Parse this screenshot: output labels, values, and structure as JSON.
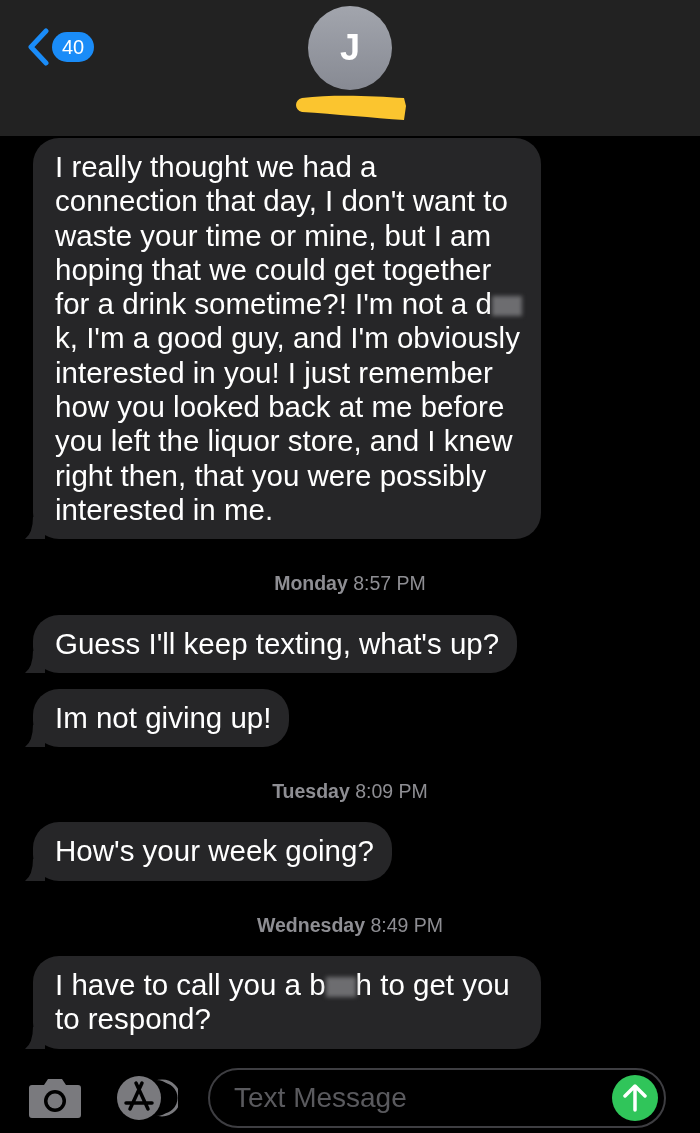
{
  "header": {
    "back_count": "40",
    "avatar_initial": "J"
  },
  "thread": [
    {
      "kind": "message",
      "parts": [
        {
          "kind": "text",
          "text": "I really thought we had a connection that day, I don't want to waste your time or mine, but I am hoping that we could get together for a drink sometime?! I'm not a d"
        },
        {
          "kind": "blur"
        },
        {
          "kind": "text",
          "text": "k, I'm a good guy, and I'm obviously interested in you! I just remember how you looked back at me before you left the liquor store, and I knew right then, that you were possibly interested in me."
        }
      ]
    },
    {
      "kind": "time",
      "day": "Monday",
      "time": "8:57 PM"
    },
    {
      "kind": "message",
      "parts": [
        {
          "kind": "text",
          "text": "Guess I'll keep texting, what's up?"
        }
      ]
    },
    {
      "kind": "message",
      "parts": [
        {
          "kind": "text",
          "text": "Im not giving up!"
        }
      ]
    },
    {
      "kind": "time",
      "day": "Tuesday",
      "time": "8:09 PM"
    },
    {
      "kind": "message",
      "parts": [
        {
          "kind": "text",
          "text": "How's your week going?"
        }
      ]
    },
    {
      "kind": "time",
      "day": "Wednesday",
      "time": "8:49 PM"
    },
    {
      "kind": "message",
      "parts": [
        {
          "kind": "text",
          "text": "I have to call you a b"
        },
        {
          "kind": "blur"
        },
        {
          "kind": "text",
          "text": "h to get you to respond?"
        }
      ]
    }
  ],
  "composer": {
    "placeholder": "Text Message"
  }
}
